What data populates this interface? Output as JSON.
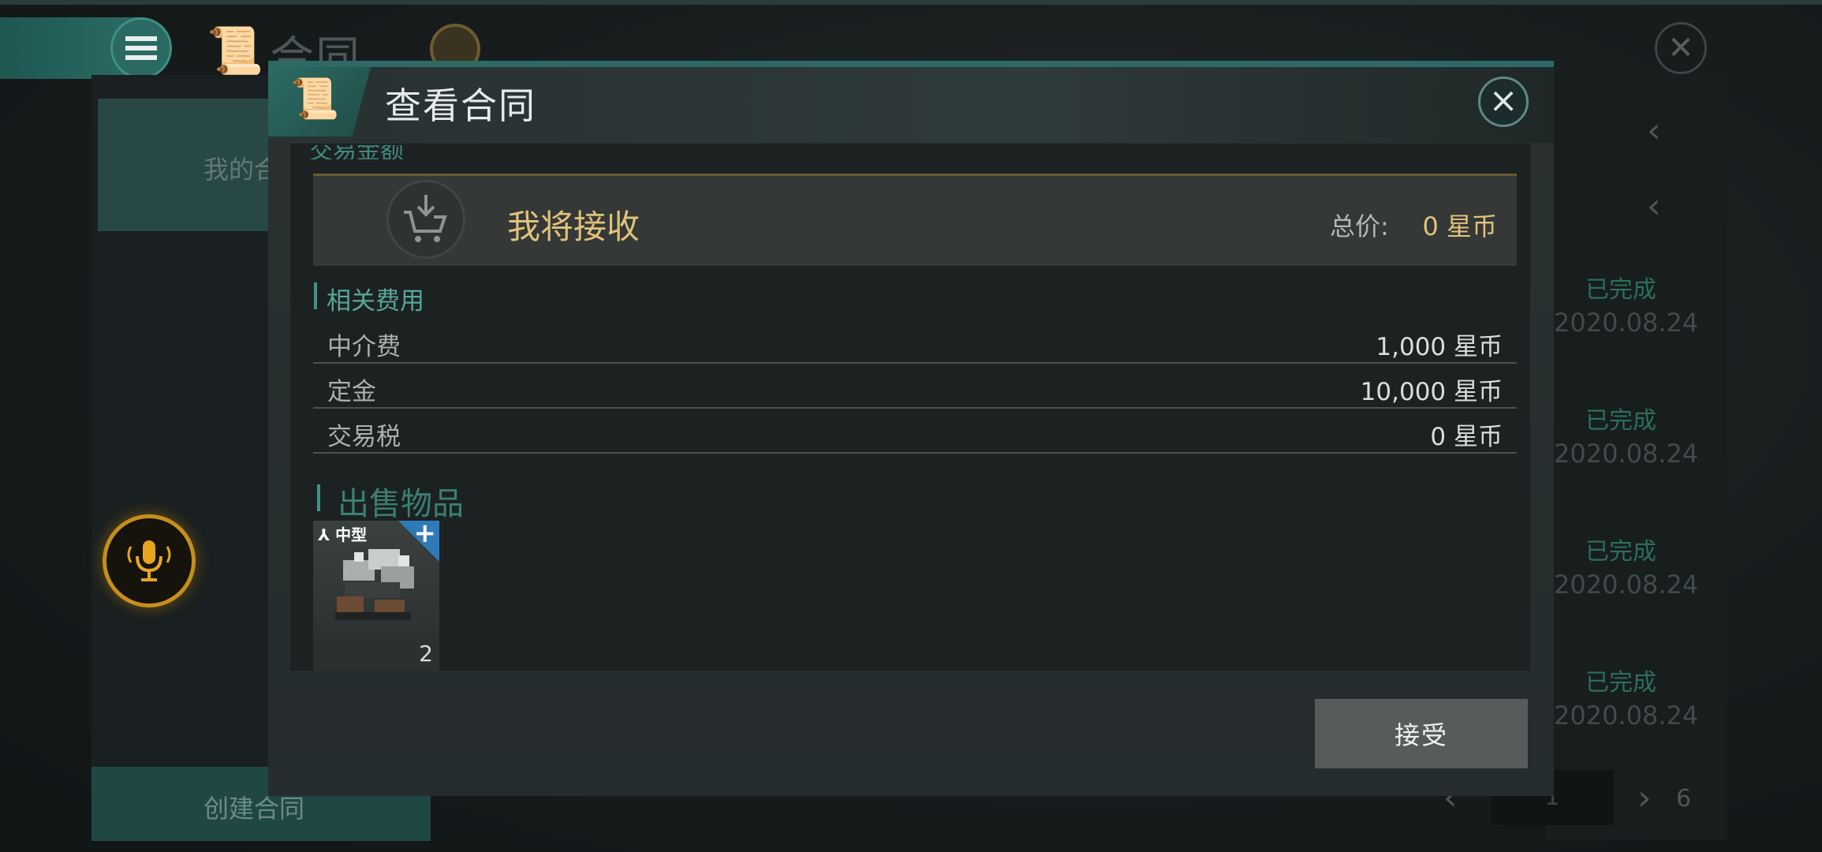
{
  "background": {
    "title": "合同",
    "my_tab": "我的合同",
    "create_contract": "创建合同",
    "status_rows": [
      {
        "status": "已完成",
        "date": "2020.08.24"
      },
      {
        "status": "已完成",
        "date": "2020.08.24"
      },
      {
        "status": "已完成",
        "date": "2020.08.24"
      },
      {
        "status": "已完成",
        "date": "2020.08.24"
      }
    ],
    "pagination": {
      "current": "1",
      "total": "6"
    }
  },
  "modal": {
    "title": "查看合同",
    "cut_heading": "交易金额",
    "receive": {
      "label": "我将接收",
      "total_label": "总价:",
      "total_value": "0 星币"
    },
    "fees_title": "相关费用",
    "fees": [
      {
        "name": "中介费",
        "value": "1,000 星币"
      },
      {
        "name": "定金",
        "value": "10,000 星币"
      },
      {
        "name": "交易税",
        "value": "0 星币"
      }
    ],
    "sale_title": "出售物品",
    "item": {
      "tag": "中型",
      "count": "2"
    },
    "accept_label": "接受"
  },
  "colors": {
    "accent": "#2c6a63",
    "gold": "#e0c27a",
    "teal_text": "#57a799"
  }
}
